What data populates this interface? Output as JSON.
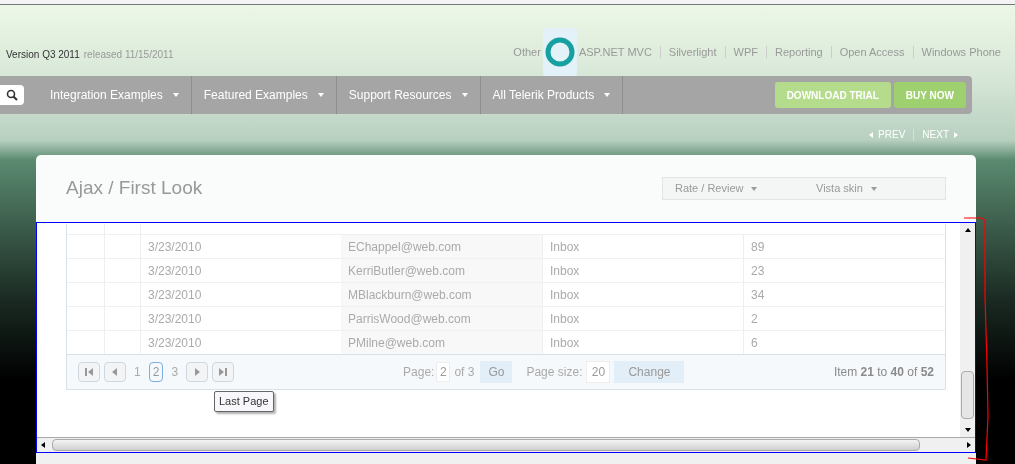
{
  "header": {
    "version": "Version Q3 2011",
    "released": "released 11/15/2011",
    "links": [
      "Other",
      "ASP.NET MVC",
      "Silverlight",
      "WPF",
      "Reporting",
      "Open Access",
      "Windows Phone"
    ]
  },
  "nav": {
    "items": [
      "Integration Examples",
      "Featured Examples",
      "Support Resources",
      "All Telerik Products"
    ],
    "buttons": [
      "DOWNLOAD TRIAL",
      "BUY NOW"
    ]
  },
  "example_nav": {
    "prev": "PREV",
    "next": "NEXT"
  },
  "card": {
    "title": "Ajax / First Look",
    "dropdowns": [
      "Rate / Review",
      "Vista skin"
    ]
  },
  "grid": {
    "rows": [
      {
        "date": "3/23/2010",
        "email": "EChappel@web.com",
        "folder": "Inbox",
        "count": "89"
      },
      {
        "date": "3/23/2010",
        "email": "KerriButler@web.com",
        "folder": "Inbox",
        "count": "23"
      },
      {
        "date": "3/23/2010",
        "email": "MBlackburn@web.com",
        "folder": "Inbox",
        "count": "34"
      },
      {
        "date": "3/23/2010",
        "email": "ParrisWood@web.com",
        "folder": "Inbox",
        "count": "2"
      },
      {
        "date": "3/23/2010",
        "email": "PMilne@web.com",
        "folder": "Inbox",
        "count": "6"
      }
    ],
    "pager": {
      "pages": [
        {
          "label": "1",
          "selected": false
        },
        {
          "label": "2",
          "selected": true
        },
        {
          "label": "3",
          "selected": false
        }
      ],
      "page_label": "Page:",
      "page_value": "2",
      "of": "of 3",
      "go": "Go",
      "size_label": "Page size:",
      "size_value": "20",
      "change": "Change",
      "summary": "Item **21** to **40** of **52**"
    },
    "tooltip": "Last Page"
  }
}
